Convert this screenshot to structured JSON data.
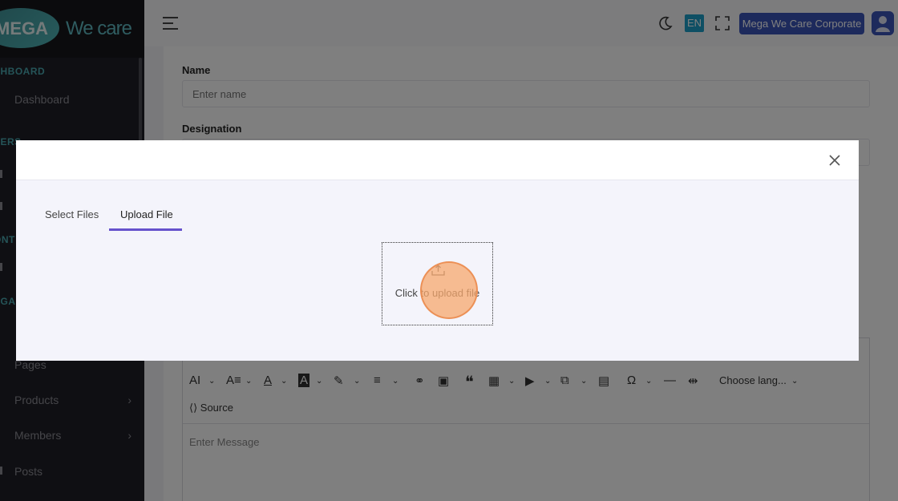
{
  "brand": {
    "name_part1": "MEGA",
    "name_part2": "We care",
    "accent": "#4fb6b8"
  },
  "sidebar": {
    "sections": [
      {
        "label": "SHBOARD"
      },
      {
        "label": "SERS"
      },
      {
        "label": "ONT"
      },
      {
        "label": "EGA"
      }
    ],
    "items": [
      {
        "label": "Dashboard"
      },
      {
        "label": "Pages"
      },
      {
        "label": "Products",
        "chevron": "›"
      },
      {
        "label": "Members",
        "chevron": "›"
      },
      {
        "label": "Posts"
      }
    ]
  },
  "header": {
    "language": "EN",
    "corporate_button": "Mega We Care Corporate",
    "accent": "#3a54b8"
  },
  "form": {
    "name_label": "Name",
    "name_placeholder": "Enter name",
    "designation_label": "Designation"
  },
  "editor": {
    "choose_lang": "Choose lang...",
    "source_label": "Source",
    "placeholder": "Enter Message"
  },
  "modal": {
    "tabs": [
      {
        "label": "Select Files",
        "active": false
      },
      {
        "label": "Upload File",
        "active": true
      }
    ],
    "upload_text": "Click to upload file",
    "tab_accent": "#6652cc"
  }
}
